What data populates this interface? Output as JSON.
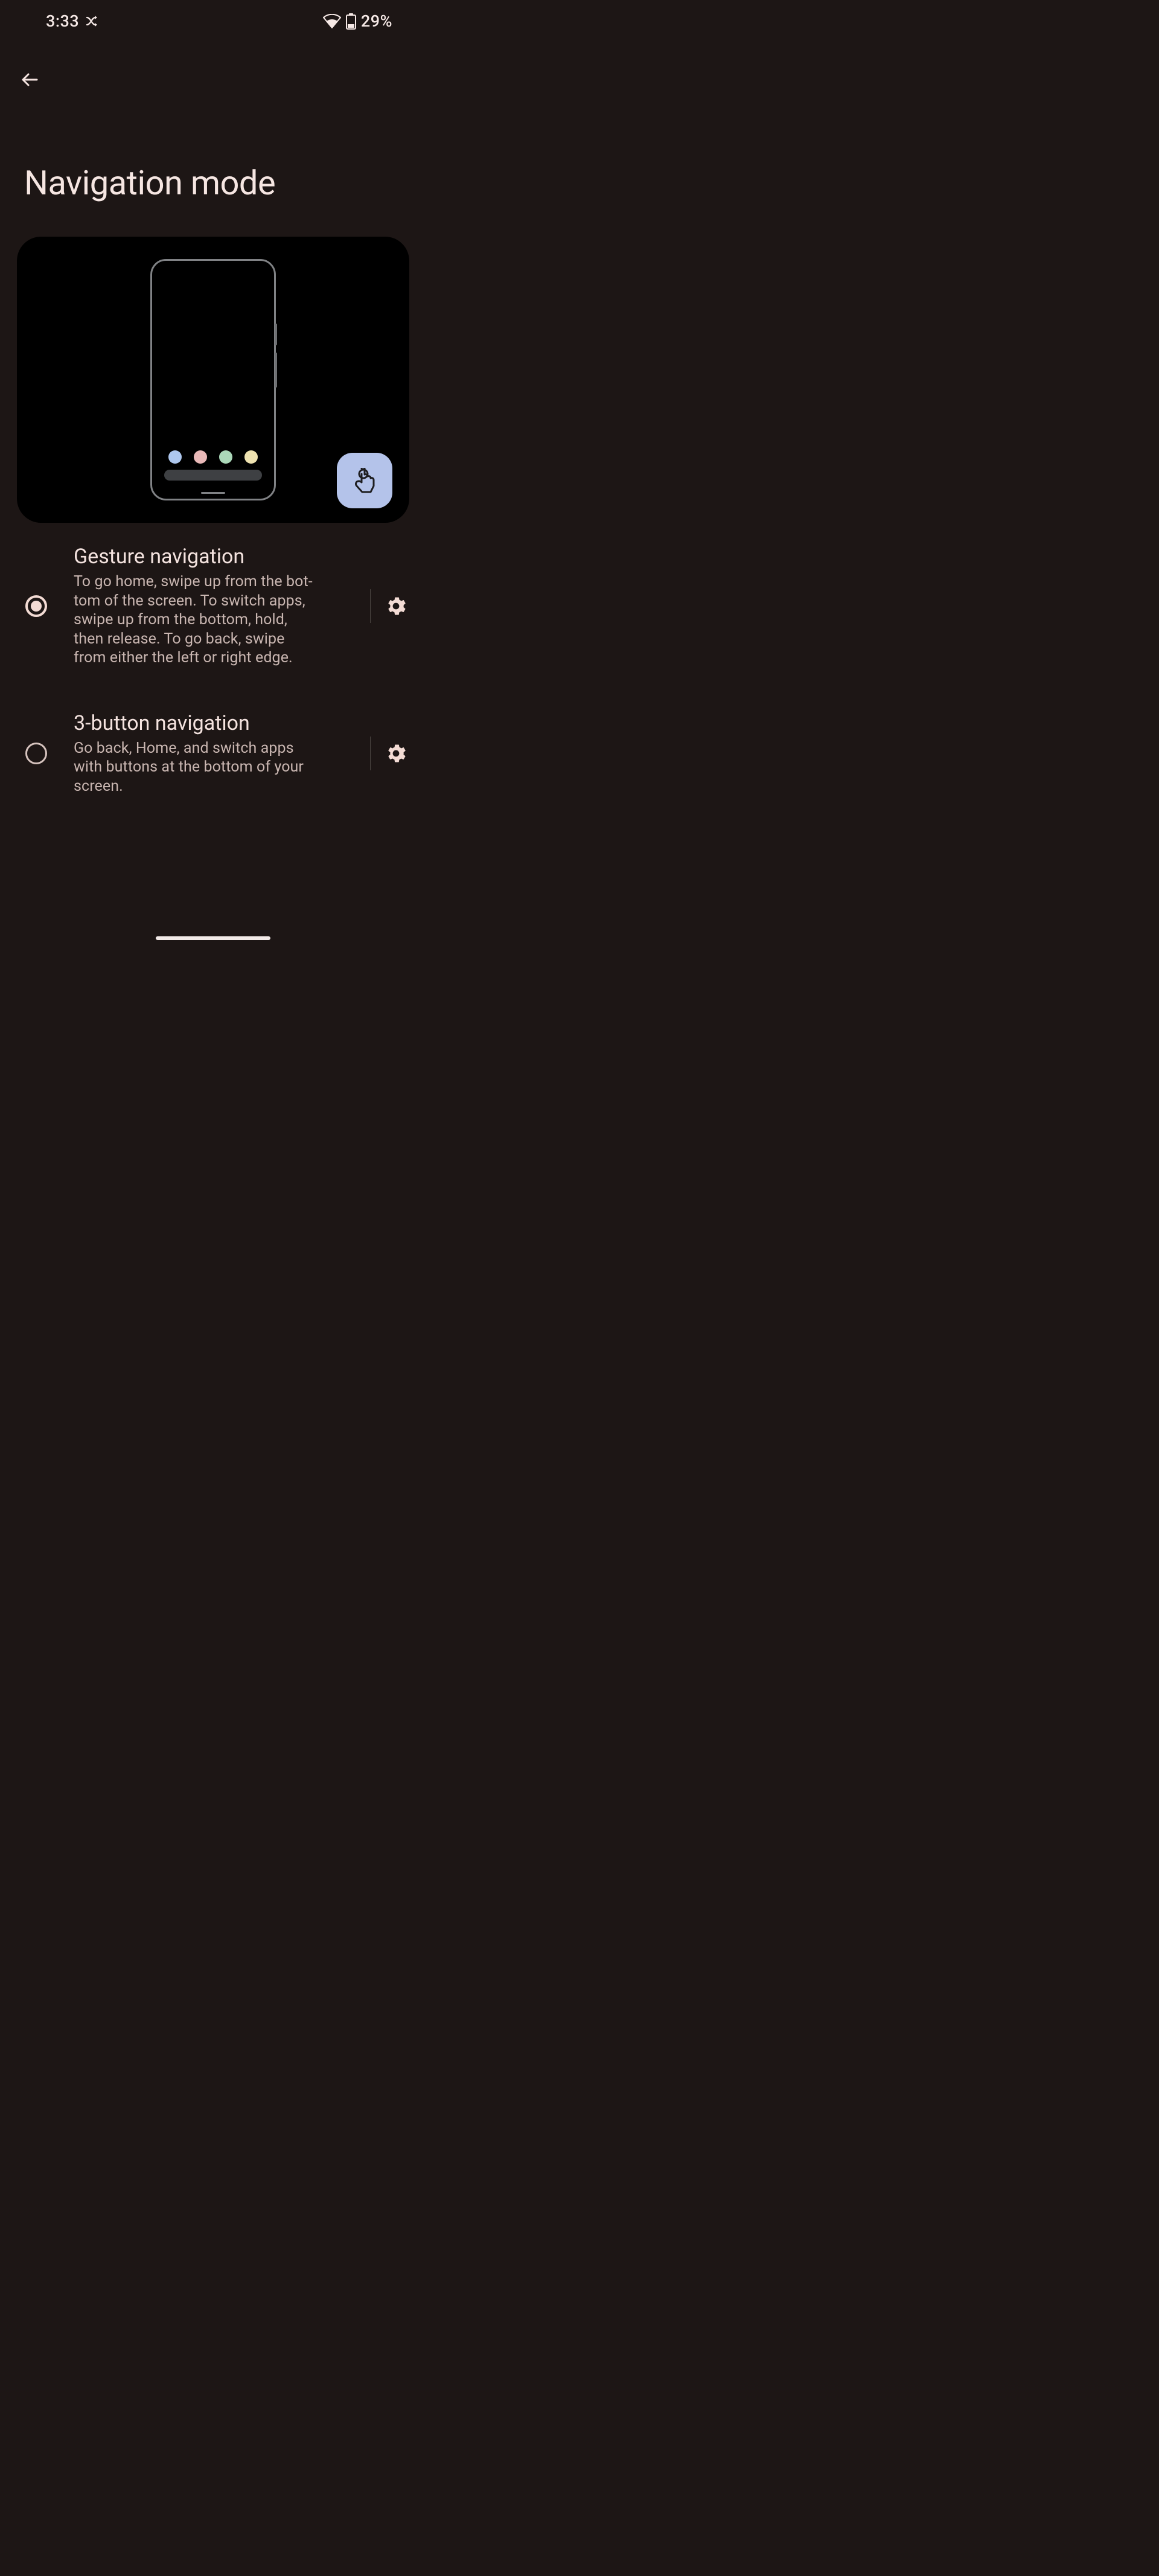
{
  "status": {
    "time": "3:33",
    "battery_pct": "29%"
  },
  "page": {
    "title": "Navigation mode"
  },
  "options": [
    {
      "key": "gesture",
      "title": "Gesture navigation",
      "desc": "To go home, swipe up from the bot­tom of the screen. To switch apps, swipe up from the bottom, hold, then release. To go back, swipe from either the left or right edge.",
      "selected": true
    },
    {
      "key": "three-button",
      "title": "3-button navigation",
      "desc": "Go back, Home, and switch apps with buttons at the bottom of your screen.",
      "selected": false
    }
  ]
}
